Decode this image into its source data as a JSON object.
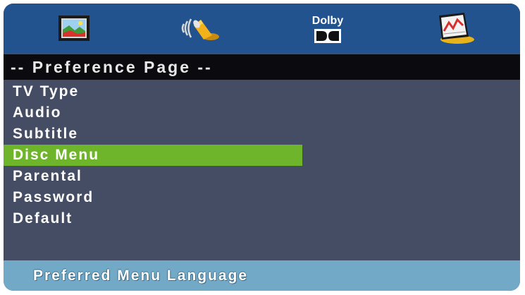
{
  "tabs": {
    "general_icon": "tv-screen-icon",
    "audio_icon": "speaker-icon",
    "dolby_label": "Dolby",
    "dolby_icon": "dolby-double-d-icon",
    "preference_icon": "preference-chart-icon"
  },
  "title": "-- Preference Page --",
  "menu": {
    "items": [
      {
        "label": "TV Type"
      },
      {
        "label": "Audio"
      },
      {
        "label": "Subtitle"
      },
      {
        "label": "Disc Menu"
      },
      {
        "label": "Parental"
      },
      {
        "label": "Password"
      },
      {
        "label": "Default"
      }
    ],
    "selected": "Disc Menu"
  },
  "status": "Preferred Menu Language",
  "colors": {
    "topbar": "#23538e",
    "titlebar": "#0b0b0f",
    "panel": "#444d63",
    "highlight": "#6fb52c",
    "statusbar": "#72a9c6"
  }
}
